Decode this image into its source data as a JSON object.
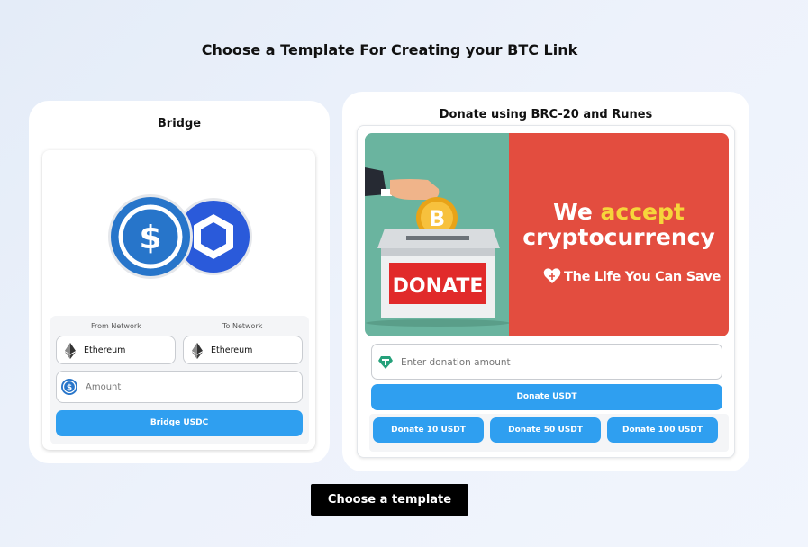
{
  "page_title": "Choose a Template For Creating your BTC Link",
  "bridge_card": {
    "title": "Bridge",
    "from_label": "From Network",
    "to_label": "To Network",
    "from_value": "Ethereum",
    "to_value": "Ethereum",
    "amount_placeholder": "Amount",
    "button_label": "Bridge USDC",
    "icons": [
      "usdc-coin-icon",
      "chainlink-coin-icon",
      "ethereum-icon",
      "usdc-icon"
    ]
  },
  "donate_card": {
    "title": "Donate using BRC-20 and Runes",
    "banner": {
      "line1_prefix": "We",
      "line1_accent": "accept",
      "line2": "cryptocurrency",
      "brand": "The Life You Can Save",
      "box_label": "DONATE",
      "coin_symbol": "B"
    },
    "amount_placeholder": "Enter donation amount",
    "donate_button": "Donate USDT",
    "quick_buttons": [
      "Donate 10 USDT",
      "Donate 50 USDT",
      "Donate 100 USDT"
    ]
  },
  "choose_button": "Choose a template",
  "colors": {
    "accent_blue": "#2f9ff0",
    "banner_green": "#6ab49f",
    "banner_red": "#e34d3f",
    "banner_yellow": "#f6d53b"
  }
}
